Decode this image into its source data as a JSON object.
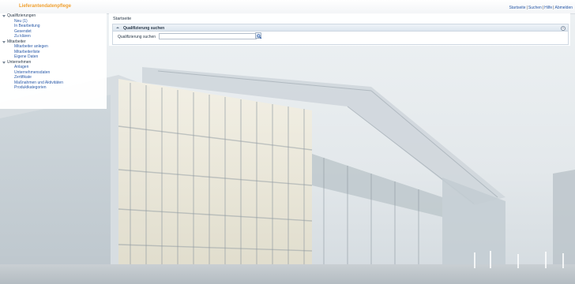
{
  "app": {
    "title": "Lieferantendatenpflege"
  },
  "top_links": [
    {
      "label": "Startseite"
    },
    {
      "label": "Suchen"
    },
    {
      "label": "Hilfe"
    },
    {
      "label": "Abmelden"
    }
  ],
  "top_links_separator": "|",
  "sidebar": {
    "groups": [
      {
        "label": "Qualifizierungen",
        "items": [
          {
            "label": "Neu (1)"
          },
          {
            "label": "In Bearbeitung"
          },
          {
            "label": "Gesendet"
          },
          {
            "label": "Zu klären"
          }
        ]
      },
      {
        "label": "Mitarbeiter",
        "items": [
          {
            "label": "Mitarbeiter anlegen"
          },
          {
            "label": "Mitarbeiterliste"
          },
          {
            "label": "Eigene Daten"
          }
        ]
      },
      {
        "label": "Unternehmen",
        "items": [
          {
            "label": "Anlagen"
          },
          {
            "label": "Unternehmensdaten"
          },
          {
            "label": "Zertifikate"
          },
          {
            "label": "Maßnahmen und Aktivitäten"
          },
          {
            "label": "Produktkategorien"
          }
        ]
      }
    ]
  },
  "main": {
    "page_title": "Startseite",
    "section": {
      "title": "Qualifizierung suchen",
      "field_label": "Qualifizierung suchen",
      "input_value": "",
      "input_placeholder": ""
    }
  },
  "colors": {
    "accent": "#f0a030",
    "link": "#2a5aa8"
  },
  "icons": {
    "search": "magnifier-icon",
    "collapse": "triangle-up-icon",
    "section_toggle": "circle-chevron-icon",
    "tree_expanded": "triangle-down-icon"
  }
}
